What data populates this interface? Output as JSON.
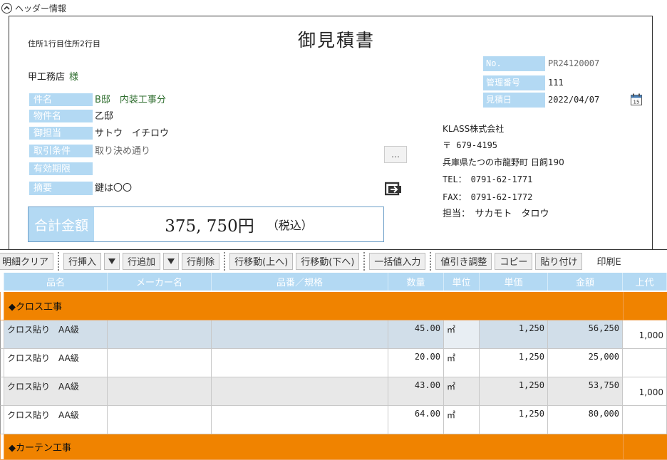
{
  "header_toggle": {
    "label": "ヘッダー情報"
  },
  "document": {
    "address": "住所1行目住所2行目",
    "title": "御見積書",
    "customer": "甲工務店",
    "honorific": "様",
    "fields": [
      {
        "label": "件名",
        "value": "B邸　内装工事分"
      },
      {
        "label": "物件名",
        "value": "乙邸"
      },
      {
        "label": "御担当",
        "value": "サトウ　イチロウ"
      },
      {
        "label": "取引条件",
        "value": "取り決め通り"
      },
      {
        "label": "有効期限",
        "value": ""
      },
      {
        "label": "摘要",
        "value": "鍵は〇〇"
      }
    ],
    "ellipsis_label": "…",
    "total": {
      "label": "合計金額",
      "amount": "375, 750円",
      "tax": "（税込）"
    },
    "meta": [
      {
        "label": "No.",
        "value": "PR24120007"
      },
      {
        "label": "管理番号",
        "value": "111"
      },
      {
        "label": "見積日",
        "value": "2022/04/07"
      }
    ],
    "company": {
      "name": "KLASS株式会社",
      "postal": "〒 679-4195",
      "address": "兵庫県たつの市龍野町 日飼190",
      "tel": "TEL：　0791-62-1771",
      "fax": "FAX：　0791-62-1772",
      "contact": "担当：　サカモト　タロウ"
    }
  },
  "toolbar": {
    "clear": "明細クリア",
    "insert": "行挿入",
    "add": "行追加",
    "delete": "行削除",
    "move_up": "行移動(上へ)",
    "move_down": "行移動(下へ)",
    "bulk_input": "一括値入力",
    "discount": "値引き調整",
    "copy": "コピー",
    "paste": "貼り付け",
    "print": "印刷E"
  },
  "grid": {
    "columns": [
      "品名",
      "メーカー名",
      "品番／規格",
      "数量",
      "単位",
      "単価",
      "金額",
      "上代"
    ],
    "rows": [
      {
        "type": "section",
        "name": "◆クロス工事"
      },
      {
        "type": "item",
        "name": "クロス貼り　AA級",
        "maker": "",
        "spec": "",
        "qty": "45.00",
        "unit": "㎡",
        "price": "1,250",
        "amount": "56,250",
        "retail": "1,000"
      },
      {
        "type": "item",
        "name": "クロス貼り　AA級",
        "maker": "",
        "spec": "",
        "qty": "20.00",
        "unit": "㎡",
        "price": "1,250",
        "amount": "25,000",
        "retail": ""
      },
      {
        "type": "item",
        "name": "クロス貼り　AA級",
        "maker": "",
        "spec": "",
        "qty": "43.00",
        "unit": "㎡",
        "price": "1,250",
        "amount": "53,750",
        "retail": "1,000"
      },
      {
        "type": "item",
        "name": "クロス貼り　AA級",
        "maker": "",
        "spec": "",
        "qty": "64.00",
        "unit": "㎡",
        "price": "1,250",
        "amount": "80,000",
        "retail": ""
      },
      {
        "type": "section",
        "name": "◆カーテン工事"
      }
    ]
  },
  "colors": {
    "label_blue": "#b3d9f3",
    "section_orange": "#f08300",
    "selected_row": "#d1dee9"
  }
}
